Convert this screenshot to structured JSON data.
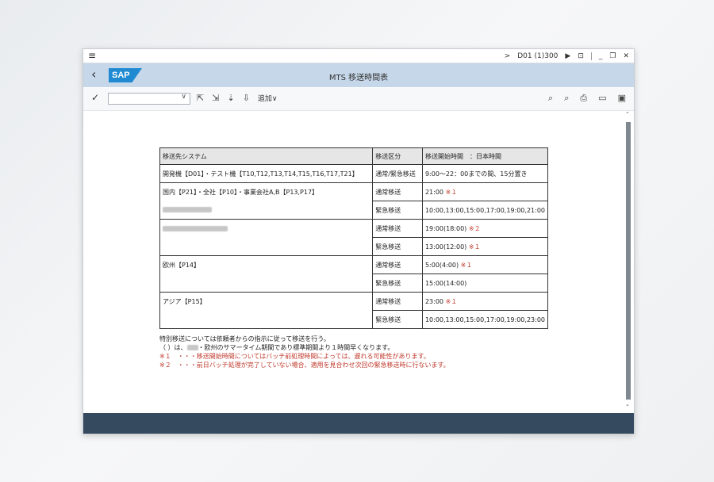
{
  "titlebar": {
    "menu_icon": "hamburger-icon",
    "session": "D01 (1)300",
    "icons": [
      "chevron-right-icon",
      "play-icon",
      "lock-icon",
      "minimize-icon",
      "restore-icon",
      "close-icon"
    ]
  },
  "header": {
    "back_icon": "back-chevron-icon",
    "logo": "SAP",
    "title": "MTS 移送時間表"
  },
  "toolbar": {
    "add_label": "追加∨",
    "dropdown_icon": "chevron-down-icon"
  },
  "table": {
    "headers": [
      "移送先システム",
      "移送区分",
      "移送開始時間　：日本時間"
    ],
    "rows": [
      {
        "system": "開発機【D01】・テスト機【T10,T12,T13,T14,T15,T16,T17,T21】",
        "type": "通常/緊急移送",
        "time": "9:00～22：00までの間、15分置き",
        "mark": ""
      },
      {
        "system": "国内【P21】・全社【P10】・事業会社A,B【P13,P17】",
        "type": "通常移送",
        "time": "21:00",
        "mark": "※１"
      },
      {
        "system": "",
        "type": "緊急移送",
        "time": "10:00,13:00,15:00,17:00,19:00,21:00",
        "mark": ""
      },
      {
        "system": "",
        "type": "通常移送",
        "time": "19:00(18:00)",
        "mark": "※２"
      },
      {
        "system": "",
        "type": "緊急移送",
        "time": "13:00(12:00)",
        "mark": "※１"
      },
      {
        "system": "欧州【P14】",
        "type": "通常移送",
        "time": "5:00(4:00)",
        "mark": "※１"
      },
      {
        "system": "",
        "type": "緊急移送",
        "time": "15:00(14:00)",
        "mark": ""
      },
      {
        "system": "アジア【P15】",
        "type": "通常移送",
        "time": "23:00",
        "mark": "※１"
      },
      {
        "system": "",
        "type": "緊急移送",
        "time": "10:00,13:00,15:00,17:00,19:00,23:00",
        "mark": ""
      }
    ]
  },
  "notes": {
    "line1": "特別移送については依頼者からの指示に従って移送を行う。",
    "line2a": "（ ）は、",
    "line2b": "・欧州のサマータイム期間であり標準期間より１時間早くなります。",
    "line3": "※１　・・・移送開始時間についてはバッチ前処理時間によっては、遅れる可能性があります。",
    "line4": "※２　・・・前日バッチ処理が完了していない場合、適用を見合わせ次回の緊急移送時に行ないます。"
  },
  "colors": {
    "sap_bar": "#c5d7e8",
    "status_bar": "#354a5f",
    "mark_red": "#c0392b",
    "logo_blue": "#1f8ad2"
  }
}
